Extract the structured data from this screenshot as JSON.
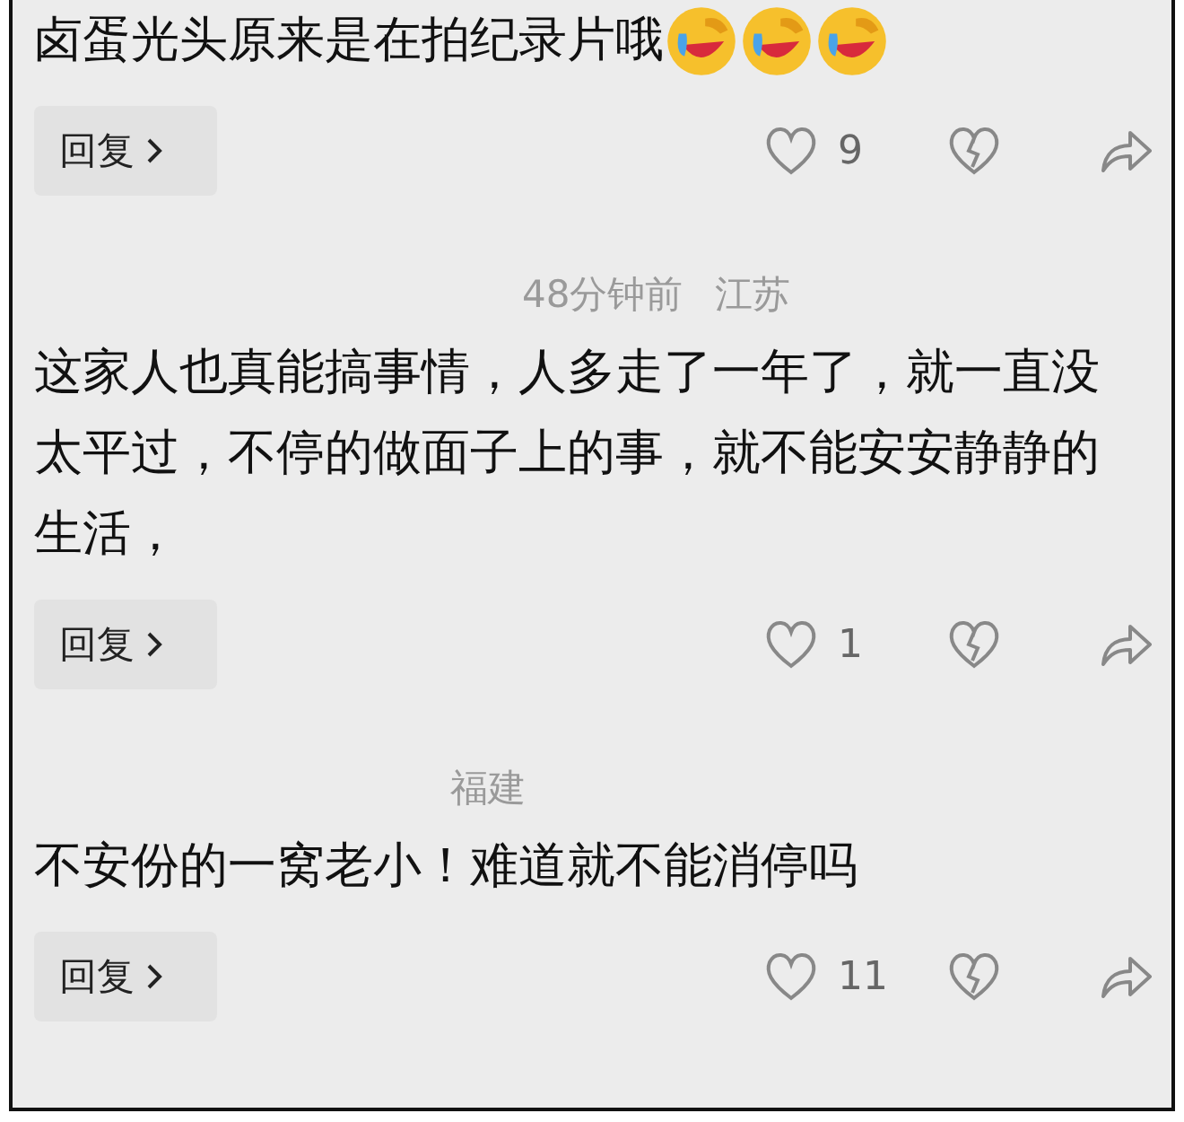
{
  "comments": [
    {
      "text": "卤蛋光头原来是在拍纪录片哦",
      "emojis": [
        {
          "kind": "cry-laugh"
        },
        {
          "kind": "cry-laugh"
        },
        {
          "kind": "cry-laugh"
        }
      ],
      "reply": "回复",
      "likes": "9"
    },
    {
      "time": "48分钟前",
      "location": "江苏",
      "text": "这家人也真能搞事情，人多走了一年了，就一直没太平过，不停的做面子上的事，就不能安安静静的生活，",
      "reply": "回复",
      "likes": "1"
    },
    {
      "location": "福建",
      "text": "不安份的一窝老小！难道就不能消停吗",
      "reply": "回复",
      "likes": "11"
    }
  ]
}
